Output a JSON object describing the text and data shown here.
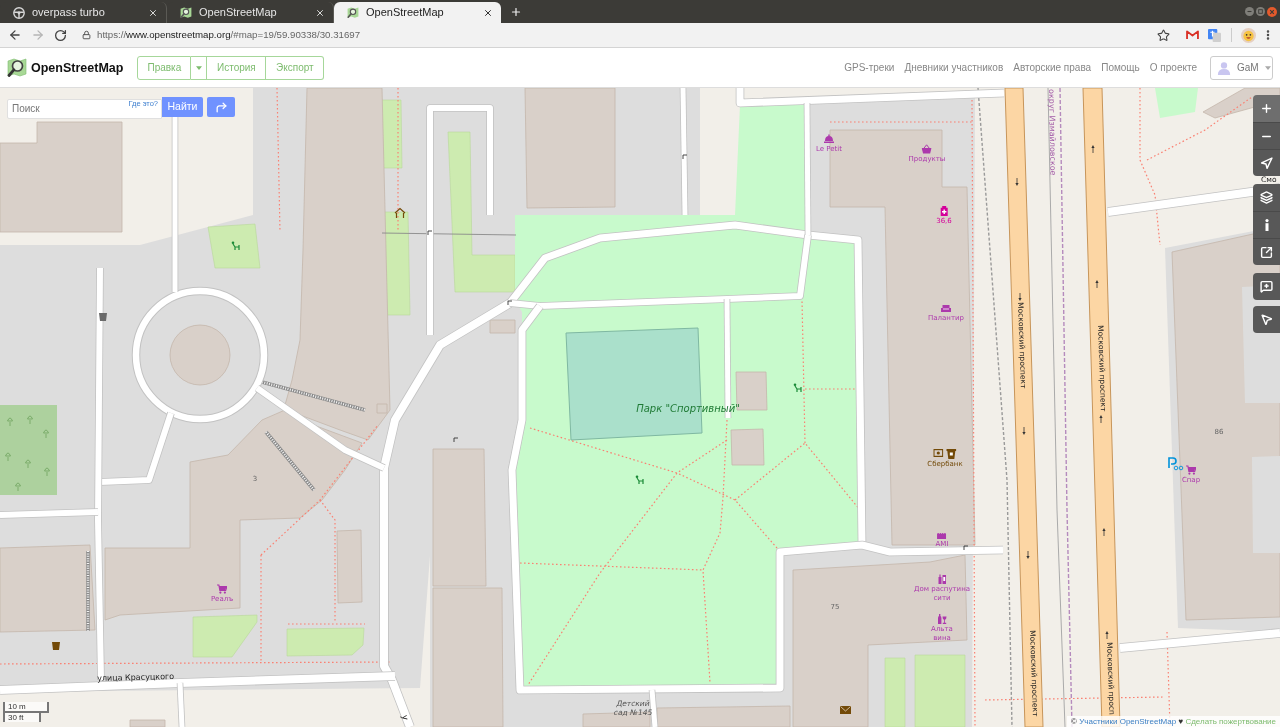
{
  "browser": {
    "tabs": [
      {
        "title": "overpass turbo",
        "selected": false
      },
      {
        "title": "OpenStreetMap",
        "selected": false
      },
      {
        "title": "OpenStreetMap",
        "selected": true
      }
    ],
    "forward_disabled": true,
    "url": {
      "scheme": "https://",
      "host": "www.openstreetmap.org",
      "path": "/#map=19/59.90338/30.31697"
    }
  },
  "header": {
    "site_name": "OpenStreetMap",
    "edit_buttons": [
      "Правка",
      "История",
      "Экспорт"
    ],
    "nav_links": [
      "GPS-треки",
      "Дневники участников",
      "Авторские права",
      "Помощь",
      "О проекте"
    ],
    "user": "GaM"
  },
  "search": {
    "placeholder": "Поиск",
    "where_link": "Где это?",
    "button": "Найти"
  },
  "map": {
    "boundary_label": "округ Измайловское",
    "pois": [
      {
        "name": "Le Petit",
        "kind": "shop"
      },
      {
        "name": "Продукты",
        "kind": "shop"
      },
      {
        "name": "36,6",
        "kind": "healthcare"
      },
      {
        "name": "Палантир",
        "kind": "shop"
      },
      {
        "name": "Сбербанк",
        "kind": "amenity"
      },
      {
        "name": "Спар",
        "kind": "shop"
      },
      {
        "name": "Реалъ",
        "kind": "shop"
      },
      {
        "name": "AMI",
        "kind": "shop"
      },
      {
        "name": "Дом распутина сити",
        "kind": "shop"
      },
      {
        "name": "Альта вина",
        "kind": "shop"
      }
    ],
    "house_numbers": [
      "86",
      "3",
      "75"
    ],
    "park_label": "Парк \"Спортивный\"",
    "school_label": "Детский сад №145",
    "streets": [
      "Смо",
      "Московский проспект",
      "Московский проспект",
      "Московский проспект",
      "Московский просп",
      "улица Красуцкого",
      "у"
    ]
  },
  "scale": {
    "metric": "10 m",
    "imperial": "30 ft"
  },
  "attribution": {
    "copyright": "©",
    "contributors": "Участники OpenStreetMap",
    "heart": "♥",
    "donate": "Сделать пожертвование"
  }
}
